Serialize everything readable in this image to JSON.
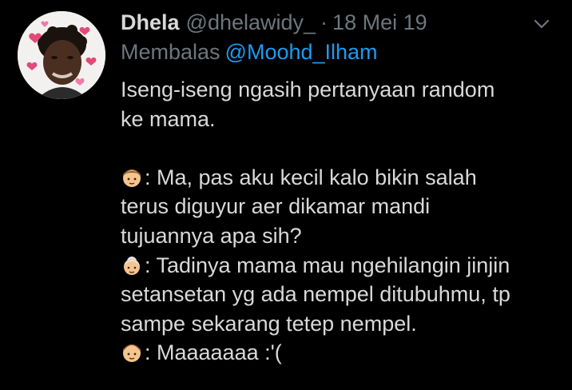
{
  "tweet": {
    "author": {
      "display_name": "Dhela",
      "handle": "@dhelawidy_",
      "avatar": "profile-photo"
    },
    "separator": "·",
    "date": "18 Mei 19",
    "more_icon": "chevron-down-icon",
    "reply": {
      "prefix": "Membalas",
      "mention": "@Moohd_Ilham"
    },
    "text": {
      "p1_line1": "Iseng-iseng ngasih pertanyaan random",
      "p1_line2": "ke mama.",
      "boy_line1": ": Ma, pas aku kecil kalo bikin salah",
      "boy_line2": "terus diguyur aer dikamar mandi",
      "boy_line3": "tujuannya apa sih?",
      "mom_line1": ": Tadinya mama mau ngehilangin jinjin",
      "mom_line2": "setansetan yg ada nempel ditubuhmu, tp",
      "mom_line3": "sampe sekarang tetep nempel.",
      "boy2_line1": ": Maaaaaaa :'("
    },
    "emojis": {
      "boy": "boy-emoji",
      "grandma": "older-woman-emoji"
    },
    "colors": {
      "background": "#000000",
      "text": "#d9d9d9",
      "secondary": "#6e767d",
      "link": "#1d9bf0"
    }
  }
}
